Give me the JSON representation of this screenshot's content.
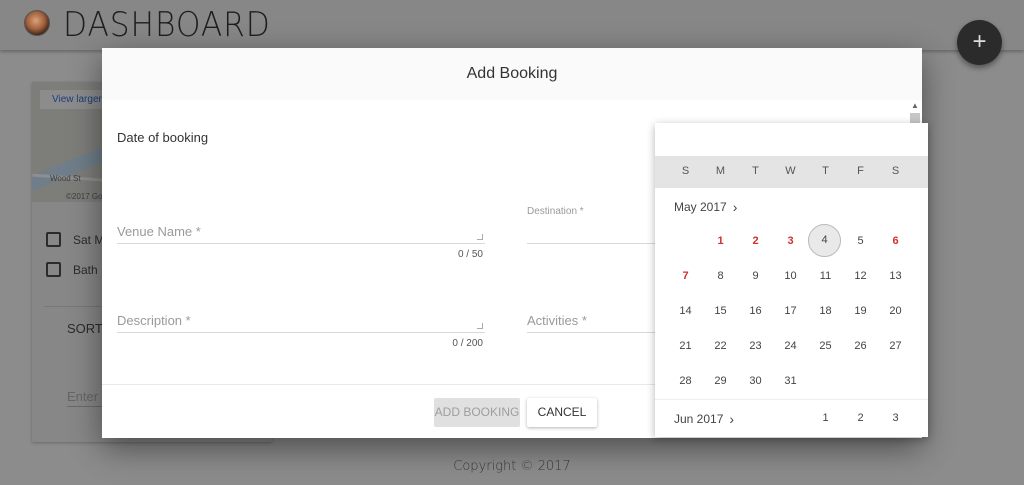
{
  "app": {
    "title": "DASHBOARD",
    "fab_label": "+",
    "copyright": "Copyright © 2017"
  },
  "background_card": {
    "map": {
      "view_larger": "View larger",
      "street": "Wood St",
      "attribution": "©2017 Go"
    },
    "date_text": "Sat M",
    "venue_text": "Bath",
    "sort_label": "SORT",
    "search_placeholder": "Enter"
  },
  "dialog": {
    "title": "Add Booking",
    "date_label": "Date of booking",
    "venue": {
      "placeholder": "Venue Name *",
      "counter": "0 / 50"
    },
    "destination": {
      "placeholder": "Destination *"
    },
    "description": {
      "placeholder": "Description *",
      "counter": "0 / 200"
    },
    "activities": {
      "placeholder": "Activities *"
    },
    "add_button": "ADD BOOKING",
    "cancel_button": "CANCEL"
  },
  "calendar": {
    "weekdays": [
      "S",
      "M",
      "T",
      "W",
      "T",
      "F",
      "S"
    ],
    "month": "May 2017",
    "next_month": "Jun 2017",
    "today": "4",
    "rows": [
      [
        "",
        "1",
        "2",
        "3",
        "4",
        "5",
        "6"
      ],
      [
        "7",
        "8",
        "9",
        "10",
        "11",
        "12",
        "13"
      ],
      [
        "14",
        "15",
        "16",
        "17",
        "18",
        "19",
        "20"
      ],
      [
        "21",
        "22",
        "23",
        "24",
        "25",
        "26",
        "27"
      ],
      [
        "28",
        "29",
        "30",
        "31",
        "",
        "",
        ""
      ]
    ],
    "highlighted_days": [
      "1",
      "2",
      "3",
      "6",
      "7"
    ],
    "next_month_days": [
      "",
      "",
      "",
      "",
      "1",
      "2",
      "3"
    ],
    "highlight_color": "#d32f2f"
  }
}
